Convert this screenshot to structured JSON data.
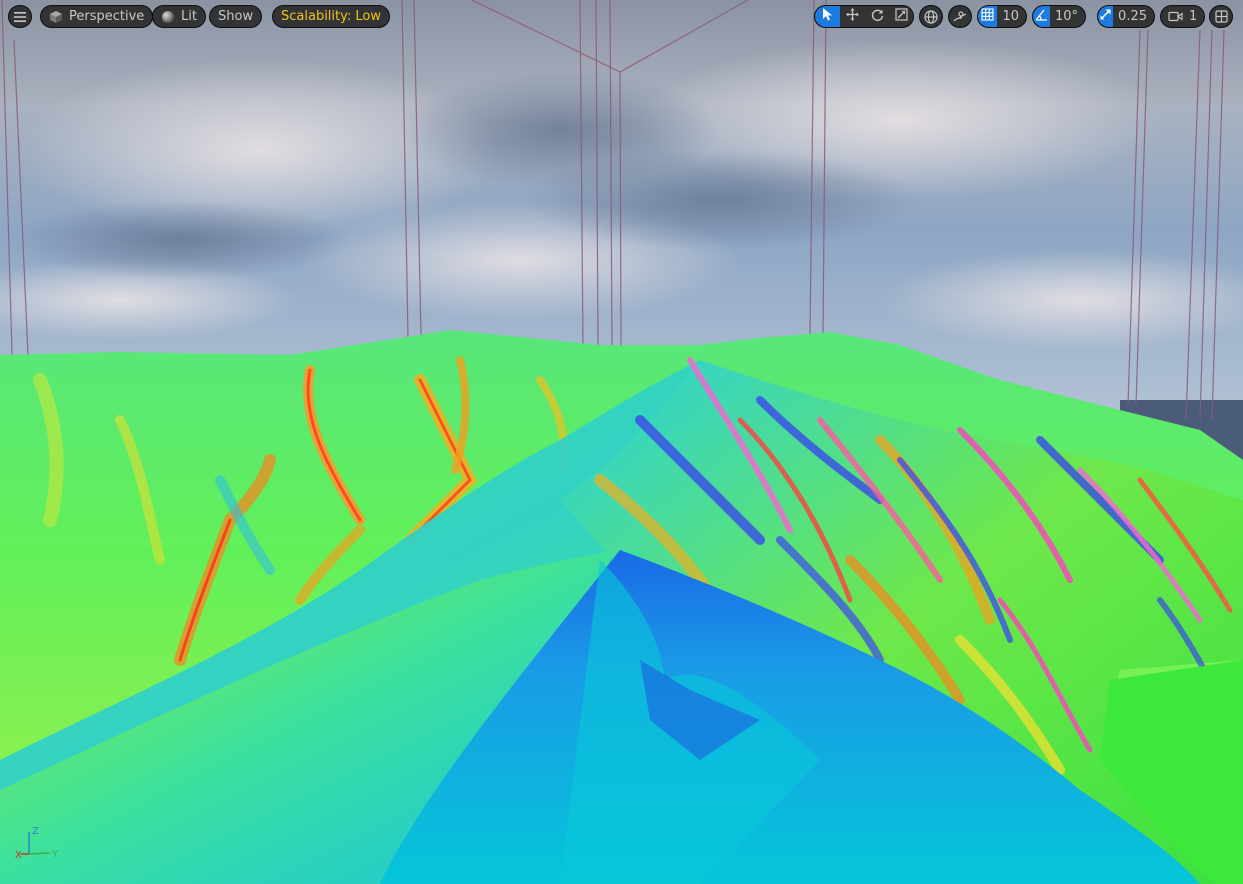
{
  "toolbar": {
    "left": {
      "menu_icon": "hamburger-icon",
      "perspective_label": "Perspective",
      "perspective_icon": "cube-icon",
      "lit_label": "Lit",
      "lit_icon": "sphere-icon",
      "show_label": "Show",
      "scalability_label": "Scalability: Low"
    },
    "right": {
      "transform_tools": [
        "select-arrow-icon",
        "translate-icon",
        "rotate-icon",
        "scale-icon"
      ],
      "world_local_icon": "globe-icon",
      "surface_snap_icon": "surface-snap-icon",
      "grid_snap_icon": "grid-icon",
      "grid_snap_value": "10",
      "rotation_snap_icon": "angle-icon",
      "rotation_snap_value": "10°",
      "scale_snap_icon": "scale-arrow-icon",
      "scale_snap_value": "0.25",
      "camera_speed_icon": "camera-icon",
      "camera_speed_value": "1",
      "layout_icon": "viewport-layout-icon"
    }
  },
  "axis_indicator": {
    "x_label": "X",
    "y_label": "Y",
    "z_label": "Z"
  },
  "colors": {
    "accent_blue": "#1d7be0",
    "scalability_text": "#f0c419",
    "toolbar_bg": "#262626",
    "axis_x": "#d62a2a",
    "axis_y": "#3cb043",
    "axis_z": "#2a7fd6"
  }
}
